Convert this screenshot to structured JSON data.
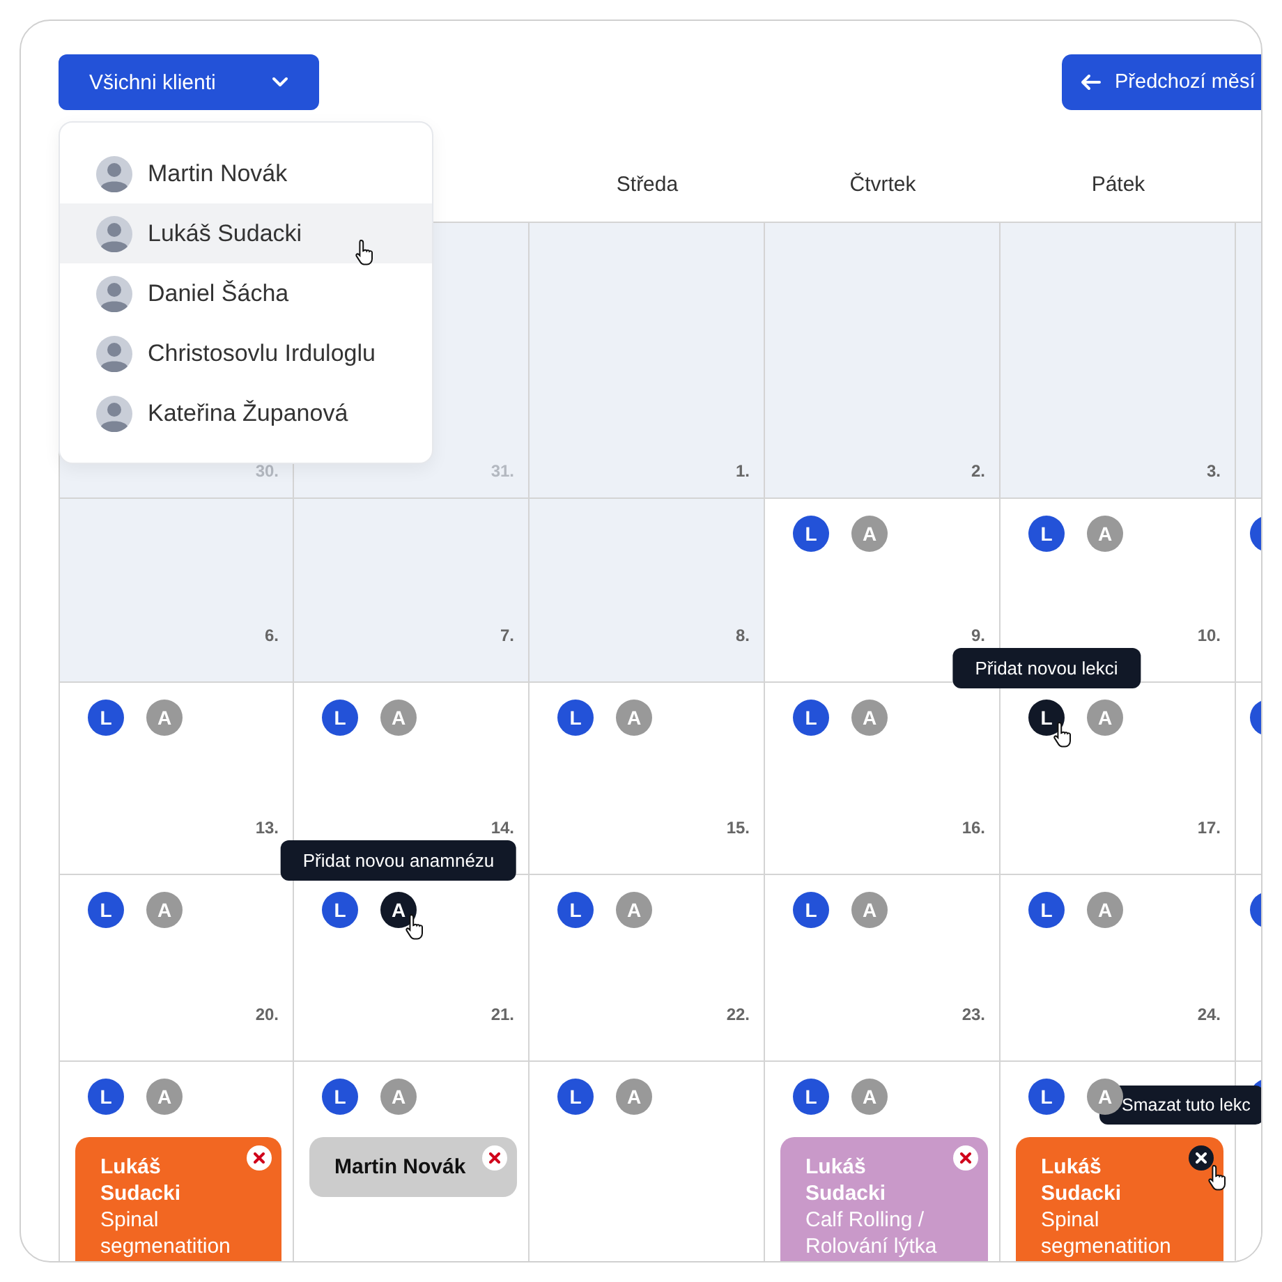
{
  "client_filter": {
    "label": "Všichni klienti",
    "expanded": true
  },
  "client_menu": [
    {
      "name": "Martin Novák",
      "hovered": false
    },
    {
      "name": "Lukáš Sudacki",
      "hovered": true
    },
    {
      "name": "Daniel Šácha",
      "hovered": false
    },
    {
      "name": "Christosovlu Irduloglu",
      "hovered": false
    },
    {
      "name": "Kateřina Županová",
      "hovered": false
    }
  ],
  "prev_month_button": {
    "label": "Předchozí měsí"
  },
  "weekdays": [
    "Středa",
    "Čtvrtek",
    "Pátek"
  ],
  "weeks": [
    [
      {
        "date": "30.",
        "past": true,
        "other_month": true
      },
      {
        "date": "31.",
        "past": true,
        "other_month": true
      },
      {
        "date": "1.",
        "past": true
      },
      {
        "date": "2.",
        "past": true
      },
      {
        "date": "3.",
        "past": true
      },
      {
        "past": true
      }
    ],
    [
      {
        "date": "6.",
        "past": true
      },
      {
        "date": "7.",
        "past": true
      },
      {
        "date": "8.",
        "past": true
      },
      {
        "date": "9.",
        "actions": [
          {
            "kind": "lesson",
            "label": "L",
            "hovered": false
          },
          {
            "kind": "anamnesis",
            "label": "A",
            "hovered": false
          }
        ]
      },
      {
        "date": "10.",
        "actions": [
          {
            "kind": "lesson",
            "label": "L",
            "hovered": false
          },
          {
            "kind": "anamnesis",
            "label": "A",
            "hovered": false
          }
        ]
      },
      {
        "actions": [
          {
            "kind": "lesson",
            "hovered": false
          }
        ]
      }
    ],
    [
      {
        "date": "13.",
        "actions": [
          {
            "kind": "lesson",
            "label": "L",
            "hovered": false
          },
          {
            "kind": "anamnesis",
            "label": "A",
            "hovered": false
          }
        ]
      },
      {
        "date": "14.",
        "actions": [
          {
            "kind": "lesson",
            "label": "L",
            "hovered": false
          },
          {
            "kind": "anamnesis",
            "label": "A",
            "hovered": false
          }
        ]
      },
      {
        "date": "15.",
        "actions": [
          {
            "kind": "lesson",
            "label": "L",
            "hovered": false
          },
          {
            "kind": "anamnesis",
            "label": "A",
            "hovered": false
          }
        ]
      },
      {
        "date": "16.",
        "actions": [
          {
            "kind": "lesson",
            "label": "L",
            "hovered": false
          },
          {
            "kind": "anamnesis",
            "label": "A",
            "hovered": false
          }
        ]
      },
      {
        "date": "17.",
        "actions": [
          {
            "kind": "lesson",
            "label": "L",
            "hovered": true,
            "tooltip": "Přidat novou lekci"
          },
          {
            "kind": "anamnesis",
            "label": "A",
            "hovered": false
          }
        ]
      },
      {
        "actions": [
          {
            "kind": "lesson",
            "hovered": false
          }
        ]
      }
    ],
    [
      {
        "date": "20.",
        "actions": [
          {
            "kind": "lesson",
            "label": "L",
            "hovered": false
          },
          {
            "kind": "anamnesis",
            "label": "A",
            "hovered": false
          }
        ]
      },
      {
        "date": "21.",
        "actions": [
          {
            "kind": "lesson",
            "label": "L",
            "hovered": false
          },
          {
            "kind": "anamnesis",
            "label": "A",
            "hovered": true,
            "tooltip": "Přidat novou anamnézu"
          }
        ]
      },
      {
        "date": "22.",
        "actions": [
          {
            "kind": "lesson",
            "label": "L",
            "hovered": false
          },
          {
            "kind": "anamnesis",
            "label": "A",
            "hovered": false
          }
        ]
      },
      {
        "date": "23.",
        "actions": [
          {
            "kind": "lesson",
            "label": "L",
            "hovered": false
          },
          {
            "kind": "anamnesis",
            "label": "A",
            "hovered": false
          }
        ]
      },
      {
        "date": "24.",
        "actions": [
          {
            "kind": "lesson",
            "label": "L",
            "hovered": false
          },
          {
            "kind": "anamnesis",
            "label": "A",
            "hovered": false
          }
        ]
      },
      {
        "actions": [
          {
            "kind": "lesson",
            "hovered": false
          }
        ]
      }
    ],
    [
      {
        "actions": [
          {
            "kind": "lesson",
            "label": "L",
            "hovered": false
          },
          {
            "kind": "anamnesis",
            "label": "A",
            "hovered": false
          }
        ],
        "events": [
          {
            "name": "Lukáš Sudacki",
            "description": "Spinal segmenatition",
            "color": "#f26722",
            "dark_text": false,
            "delete_hovered": false
          }
        ]
      },
      {
        "actions": [
          {
            "kind": "lesson",
            "label": "L",
            "hovered": false
          },
          {
            "kind": "anamnesis",
            "label": "A",
            "hovered": false
          }
        ],
        "events": [
          {
            "name": "Martin Novák",
            "color": "#cccccc",
            "dark_text": true,
            "delete_hovered": false
          }
        ]
      },
      {
        "actions": [
          {
            "kind": "lesson",
            "label": "L",
            "hovered": false
          },
          {
            "kind": "anamnesis",
            "label": "A",
            "hovered": false
          }
        ]
      },
      {
        "actions": [
          {
            "kind": "lesson",
            "label": "L",
            "hovered": false
          },
          {
            "kind": "anamnesis",
            "label": "A",
            "hovered": false
          }
        ],
        "events": [
          {
            "name": "Lukáš Sudacki",
            "description": "Calf Rolling / Rolování lýtka",
            "color": "#c999c9",
            "dark_text": false,
            "delete_hovered": false
          }
        ]
      },
      {
        "actions": [
          {
            "kind": "lesson",
            "label": "L",
            "hovered": false
          },
          {
            "kind": "anamnesis",
            "label": "A",
            "hovered": false
          }
        ],
        "events": [
          {
            "name": "Lukáš Sudacki",
            "description": "Spinal segmenatition",
            "color": "#f26722",
            "dark_text": false,
            "delete_hovered": true,
            "tooltip": "Smazat tuto lekc"
          }
        ]
      },
      {
        "actions": [
          {
            "kind": "lesson",
            "hovered": false
          }
        ]
      }
    ]
  ]
}
